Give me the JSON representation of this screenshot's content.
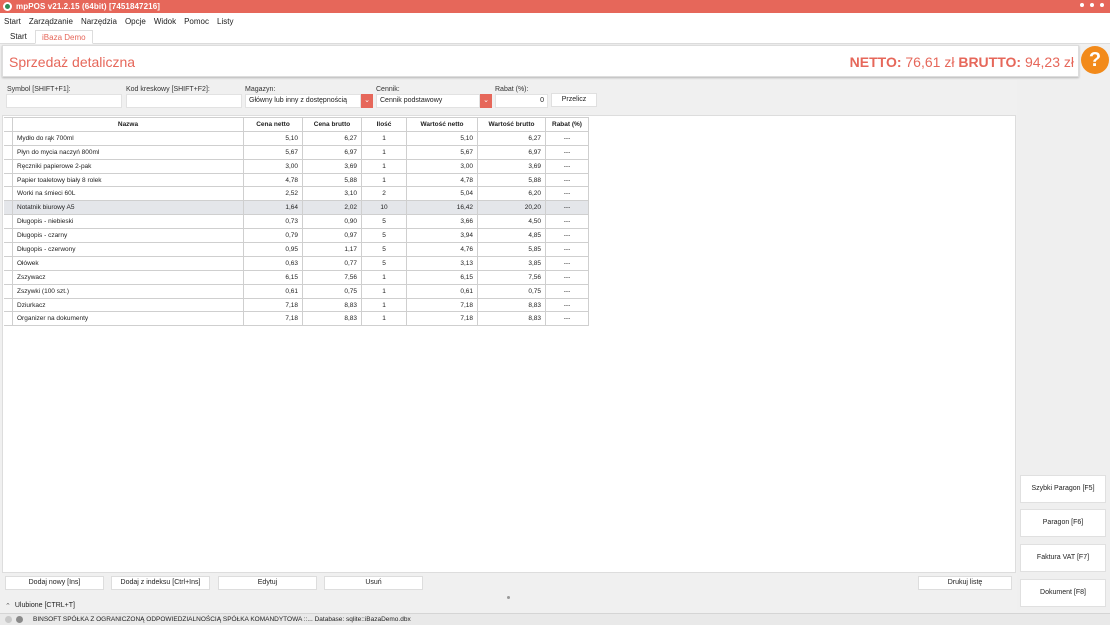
{
  "window": {
    "title": "mpPOS v21.2.15 (64bit) [7451847216]"
  },
  "menu": [
    "Start",
    "Zarządzanie",
    "Narzędzia",
    "Opcje",
    "Widok",
    "Pomoc",
    "Listy"
  ],
  "tabs": [
    "Start",
    "iBaza Demo"
  ],
  "header": {
    "title": "Sprzedaż detaliczna",
    "netto_label": "NETTO:",
    "netto_value": "76,61 zł",
    "brutto_label": "BRUTTO:",
    "brutto_value": "94,23 zł",
    "help_icon": "?"
  },
  "fields": {
    "symbol_label": "Symbol [SHIFT+F1]:",
    "symbol_value": "",
    "barcode_label": "Kod kreskowy [SHIFT+F2]:",
    "barcode_value": "",
    "warehouse_label": "Magazyn:",
    "warehouse_value": "Główny lub inny z dostępnością",
    "pricelist_label": "Cennik:",
    "pricelist_value": "Cennik podstawowy",
    "discount_label": "Rabat (%):",
    "discount_value": "0",
    "recalc_label": "Przelicz"
  },
  "grid": {
    "columns": [
      "Nazwa",
      "Cena netto",
      "Cena brutto",
      "Ilość",
      "Wartość netto",
      "Wartość brutto",
      "Rabat (%)"
    ],
    "rows": [
      [
        "Mydło do rąk 700ml",
        "5,10",
        "6,27",
        "1",
        "5,10",
        "6,27",
        "---"
      ],
      [
        "Płyn do mycia naczyń 800ml",
        "5,67",
        "6,97",
        "1",
        "5,67",
        "6,97",
        "---"
      ],
      [
        "Ręczniki papierowe 2-pak",
        "3,00",
        "3,69",
        "1",
        "3,00",
        "3,69",
        "---"
      ],
      [
        "Papier toaletowy biały 8 rolek",
        "4,78",
        "5,88",
        "1",
        "4,78",
        "5,88",
        "---"
      ],
      [
        "Worki na śmieci 60L",
        "2,52",
        "3,10",
        "2",
        "5,04",
        "6,20",
        "---"
      ],
      [
        "Notatnik biurowy A5",
        "1,64",
        "2,02",
        "10",
        "16,42",
        "20,20",
        "---"
      ],
      [
        "Długopis - niebieski",
        "0,73",
        "0,90",
        "5",
        "3,66",
        "4,50",
        "---"
      ],
      [
        "Długopis - czarny",
        "0,79",
        "0,97",
        "5",
        "3,94",
        "4,85",
        "---"
      ],
      [
        "Długopis - czerwony",
        "0,95",
        "1,17",
        "5",
        "4,76",
        "5,85",
        "---"
      ],
      [
        "Ołówek",
        "0,63",
        "0,77",
        "5",
        "3,13",
        "3,85",
        "---"
      ],
      [
        "Zszywacz",
        "6,15",
        "7,56",
        "1",
        "6,15",
        "7,56",
        "---"
      ],
      [
        "Zszywki (100 szt.)",
        "0,61",
        "0,75",
        "1",
        "0,61",
        "0,75",
        "---"
      ],
      [
        "Dziurkacz",
        "7,18",
        "8,83",
        "1",
        "7,18",
        "8,83",
        "---"
      ],
      [
        "Organizer na dokumenty",
        "7,18",
        "8,83",
        "1",
        "7,18",
        "8,83",
        "---"
      ]
    ],
    "selected_row": 5
  },
  "side_buttons": [
    "Szybki Paragon [F5]",
    "Paragon [F6]",
    "Faktura VAT [F7]",
    "Dokument [F8]"
  ],
  "bottom_buttons": [
    "Dodaj nowy [Ins]",
    "Dodaj z indeksu [Ctrl+Ins]",
    "Edytuj",
    "Usuń",
    "Drukuj listę"
  ],
  "favorites": {
    "icon": "chevron-up-icon",
    "label": "Ulubione [CTRL+T]"
  },
  "status": {
    "text": "BINSOFT SPÓŁKA Z OGRANICZONĄ ODPOWIEDZIALNOŚCIĄ SPÓŁKA KOMANDYTOWA ::... Database: sqlite::iBazaDemo.dbx"
  },
  "colors": {
    "accent": "#e6675a",
    "help": "#f28a1a"
  }
}
